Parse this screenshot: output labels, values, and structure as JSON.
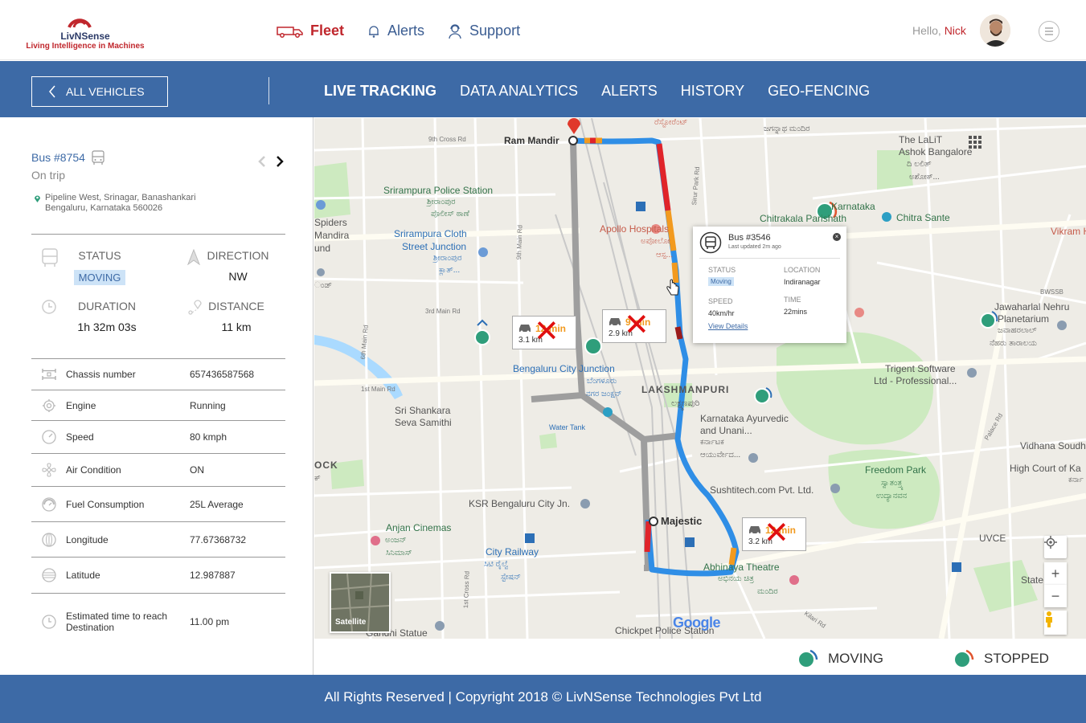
{
  "brand": {
    "name": "LivNSense",
    "tagline": "Living Intelligence in Machines"
  },
  "topnav": [
    {
      "label": "Fleet",
      "icon": "truck-icon",
      "active": true
    },
    {
      "label": "Alerts",
      "icon": "bell-icon",
      "active": false
    },
    {
      "label": "Support",
      "icon": "support-agent-icon",
      "active": false
    }
  ],
  "user": {
    "greeting": "Hello,",
    "name": "Nick"
  },
  "subbar": {
    "back_label": "ALL VEHICLES",
    "tabs": [
      "LIVE TRACKING",
      "DATA ANALYTICS",
      "ALERTS",
      "HISTORY",
      "GEO-FENCING"
    ],
    "active_tab": "LIVE TRACKING"
  },
  "vehicle": {
    "title": "Bus #8754",
    "state": "On trip",
    "address_line1": "Pipeline West, Srinagar, Banashankari",
    "address_line2": "Bengaluru, Karnataka 560026",
    "status_label": "STATUS",
    "status_value": "MOVING",
    "direction_label": "DIRECTION",
    "direction_value": "NW",
    "duration_label": "DURATION",
    "duration_value": "1h 32m 03s",
    "distance_label": "DISTANCE",
    "distance_value": "11 km"
  },
  "details": [
    {
      "label": "Chassis number",
      "value": "657436587568",
      "icon": "chassis-icon"
    },
    {
      "label": "Engine",
      "value": "Running",
      "icon": "engine-icon"
    },
    {
      "label": "Speed",
      "value": "80 kmph",
      "icon": "speedometer-icon"
    },
    {
      "label": "Air Condition",
      "value": "ON",
      "icon": "fan-icon"
    },
    {
      "label": "Fuel Consumption",
      "value": "25L Average",
      "icon": "fuel-gauge-icon"
    },
    {
      "label": "Longitude",
      "value": "77.67368732",
      "icon": "globe-icon"
    },
    {
      "label": "Latitude",
      "value": "12.987887",
      "icon": "latitude-icon"
    },
    {
      "label": "Estimated time to reach Destination",
      "value": "11.00 pm",
      "icon": "clock-icon"
    }
  ],
  "map": {
    "places": {
      "ram_mandir": "Ram Mandir",
      "majestic": "Majestic",
      "lakshmanpuri": "LAKSHMANPURI",
      "lakshmanpuri_kn": "ಲಕ್ಷ್ಮಣಪುರಿ",
      "srirampura_police": "Srirampura Police Station",
      "srirampura_police_kn": "ಶ್ರೀರಾಂಪುರ",
      "srirampura_police_kn2": "ಪೊಲೀಸ್ ಠಾಣೆ",
      "srirampura_cloth": "Srirampura Cloth",
      "street_junction": "Street Junction",
      "street_junction_kn": "ಶ್ರೀರಾಂಪುರ",
      "street_junction_kn2": "ಕ್ಲಾತ್...",
      "apollo": "Apollo Hospitals",
      "apollo_kn": "ಅಪೋಲೋ",
      "apollo_kn2": "ಆಸ್ಪ...",
      "bengaluru_city_junction": "Bengaluru City Junction",
      "bengaluru_city_junction_kn": "ಬೆಂಗಳೂರು",
      "bengaluru_city_junction_kn2": "ನಗರ ಜಂಕ್ಷನ್",
      "sri_shankara": "Sri Shankara",
      "seva_samithi": "Seva Samithi",
      "water_tank": "Water Tank",
      "ksr": "KSR Bengaluru City Jn.",
      "anjan": "Anjan Cinemas",
      "anjan_kn": "ಅಂಜನ್",
      "anjan_kn2": "ಸಿನಿಮಾಸ್",
      "city_railway": "City Railway",
      "city_railway_kn": "ಸಿಟಿ ರೈಲ್ವೆ",
      "city_railway_kn2": "ಸ್ಟೇಷನ್",
      "abhinaya": "Abhinaya Theatre",
      "abhinaya_kn": "ಅಭಿನಯ ಚಿತ್ರ",
      "abhinaya_kn2": "ಮಂದಿರ",
      "chickpet": "Chickpet Police Station",
      "gandhi": "Gandhi Statue",
      "sushtitech": "Sushtitech.com Pvt. Ltd.",
      "karnataka_ayurvedic": "Karnataka Ayurvedic",
      "ayurvedic2": "and Unani...",
      "ayurvedic_kn": "ಕರ್ನಾಟಕ",
      "ayurvedic_kn2": "ಆಯುರ್ವೇದ...",
      "freedom_park": "Freedom Park",
      "freedom_kn": "ಸ್ವಾತಂತ್ರ್ಯ",
      "freedom_kn2": "ಉದ್ಯಾನವನ",
      "lalit": "The LaLiT",
      "lalit2": "Ashok Bangalore",
      "lalit_kn": "ಅಶೋಕ್...",
      "lalit_kn0": "ದಿ ಲಲಿತ್",
      "chitrakala": "Chitrakala Parishath",
      "chitrakala_top": "Karnataka",
      "chitra_sante": "Chitra Sante",
      "vikram": "Vikram Ho",
      "jawaharlal": "Jawaharlal Nehru",
      "planetarium": "Planetarium",
      "jawaharlal_kn": "ಜವಾಹರಲಾಲ್",
      "jawaharlal_kn2": "ನೆಹರು ತಾರಾಲಯ",
      "trigent": "Trigent Software",
      "trigent2": "Ltd - Professional...",
      "vidhana": "Vidhana Soudha",
      "high_court": "High Court of Ka",
      "high_court_kn": "ಕರ್ನಾ",
      "uvce": "UVCE",
      "state_ce": "State Ce",
      "bwssb": "BWSSB",
      "spiders": "Spiders",
      "mandira": "Mandira",
      "und": "und",
      "rnd": "ಂಡ್",
      "ock": "OCK",
      "ock_kn": "ಕ್",
      "jagannath": "ಜಗನ್ನಾಥ ಮಂದಿರ",
      "restaurant": "ರೆಸ್ಟೋರೆಂಟ್",
      "cross_9th": "9th Cross Rd",
      "main_9th": "9th Main Rd",
      "main_3rd": "3rd Main Rd",
      "main_6th": "6th Main Rd",
      "main_1st": "1st Main Rd",
      "cross_1st": "1st Cross Rd",
      "sirur": "Sirur Park Rd",
      "palace": "Palace Rd",
      "kilari": "Kilari Rd"
    },
    "eta": [
      {
        "time": "12 min",
        "distance": "3.1 km"
      },
      {
        "time": "9 min",
        "distance": "2.9 km"
      },
      {
        "time": "12 min",
        "distance": "3.2 km"
      }
    ],
    "popup": {
      "bus": "Bus #3546",
      "updated": "Last updated 2m ago",
      "status_label": "STATUS",
      "status_value": "Moving",
      "location_label": "LOCATION",
      "location_value": "Indiranagar",
      "speed_label": "SPEED",
      "speed_value": "40km/hr",
      "time_label": "TIME",
      "time_value": "22mins",
      "link": "View Details"
    },
    "satellite_label": "Satellite",
    "google_label": "Google",
    "zoom_in": "+",
    "zoom_out": "−"
  },
  "legend": {
    "moving": "MOVING",
    "stopped": "STOPPED",
    "moving_color": "#2f9e7b",
    "stopped_color": "#e0542e"
  },
  "footer": "All Rights Reserved | Copyright 2018 © LivNSense Technologies Pvt Ltd",
  "colors": {
    "brand_blue": "#3d6aa6",
    "brand_red": "#c0272d",
    "route": "#2f8ee6"
  }
}
